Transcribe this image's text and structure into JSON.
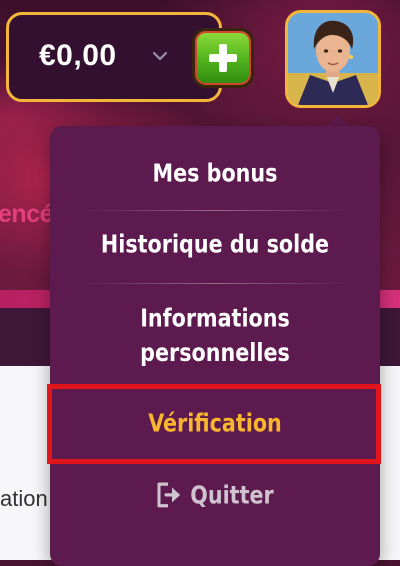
{
  "header": {
    "balance": "€0,00",
    "chevron_icon": "chevron-down-icon",
    "deposit_icon": "plus-icon",
    "avatar_icon": "user-avatar"
  },
  "background": {
    "hero_text_fragment": "encé",
    "content_text_fragment": "ation"
  },
  "menu": {
    "items": [
      {
        "label": "Mes bonus"
      },
      {
        "label": "Historique du solde"
      },
      {
        "label_line1": "Informations",
        "label_line2": "personnelles"
      },
      {
        "label": "Vérification",
        "highlighted": true
      },
      {
        "label": "Quitter",
        "icon": "logout-icon"
      }
    ]
  },
  "colors": {
    "accent_gold": "#f4b63a",
    "menu_bg": "#5c1a4f",
    "highlight_text": "#f8b62e",
    "selection_border": "#e0161c",
    "deposit_green": "#4fb21c"
  }
}
